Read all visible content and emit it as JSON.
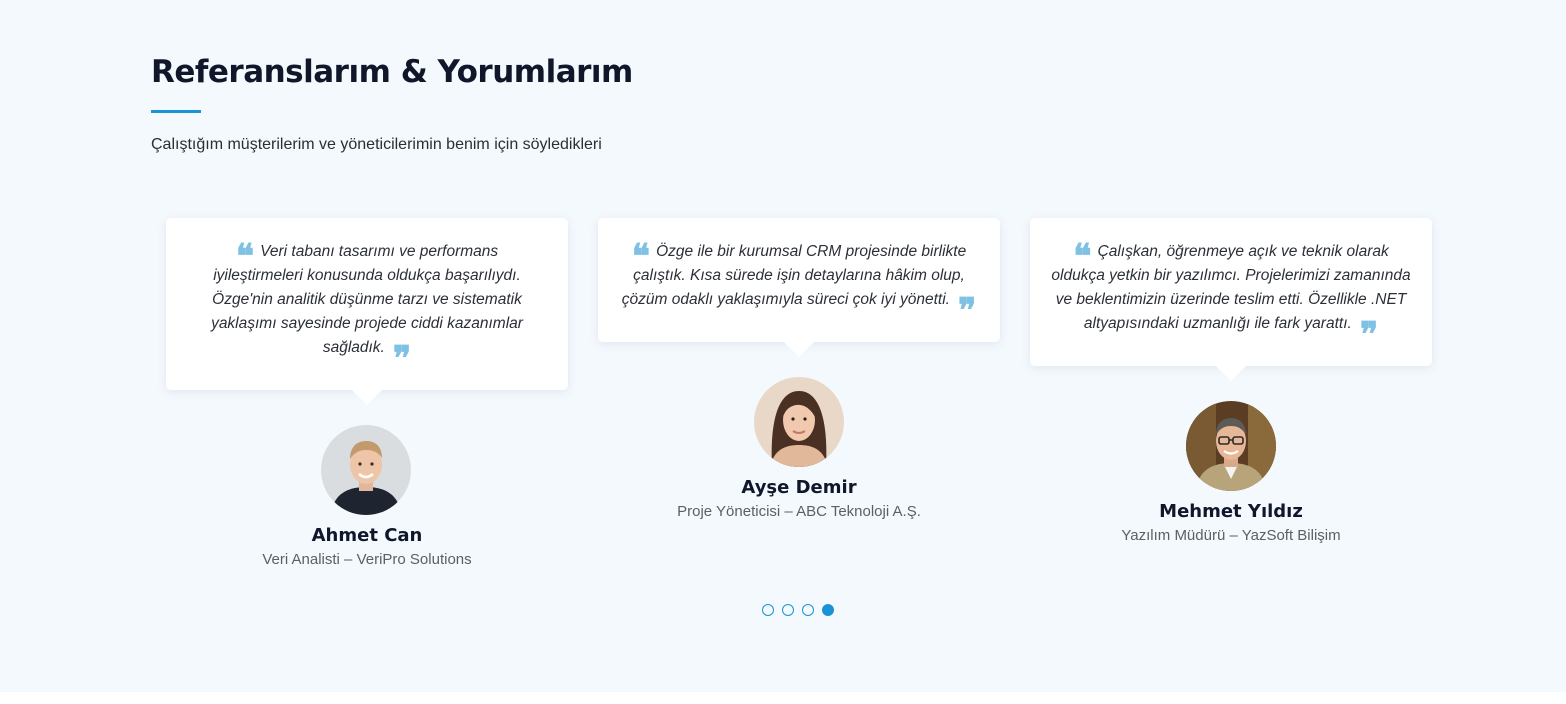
{
  "section": {
    "title": "Referanslarım & Yorumlarım",
    "subtitle": "Çalıştığım müşterilerim ve yöneticilerimin benim için söyledikleri",
    "accent_color": "#1b93d4",
    "background_color": "#f4f9fd"
  },
  "quote_marks": {
    "open": "❝",
    "close": "❞",
    "color": "#7fc1e4"
  },
  "testimonials": [
    {
      "quote": "Veri tabanı tasarımı ve performans iyileştirmeleri konusunda oldukça başarılıydı. Özge'nin analitik düşünme tarzı ve sistematik yaklaşımı sayesinde projede ciddi kazanımlar sağladık.",
      "name": "Ahmet Can",
      "role": "Veri Analisti – VeriPro Solutions",
      "avatar": "man-photo-icon"
    },
    {
      "quote": "Özge ile bir kurumsal CRM projesinde birlikte çalıştık. Kısa sürede işin detaylarına hâkim olup, çözüm odaklı yaklaşımıyla süreci çok iyi yönetti.",
      "name": "Ayşe Demir",
      "role": "Proje Yöneticisi – ABC Teknoloji A.Ş.",
      "avatar": "woman-photo-icon"
    },
    {
      "quote": "Çalışkan, öğrenmeye açık ve teknik olarak oldukça yetkin bir yazılımcı. Projelerimizi zamanında ve beklentimizin üzerinde teslim etti. Özellikle .NET altyapısındaki uzmanlığı ile fark yarattı.",
      "name": "Mehmet Yıldız",
      "role": "Yazılım Müdürü – YazSoft Bilişim",
      "avatar": "man-glasses-photo-icon"
    }
  ],
  "carousel": {
    "page_count": 4,
    "active_page": 4
  }
}
